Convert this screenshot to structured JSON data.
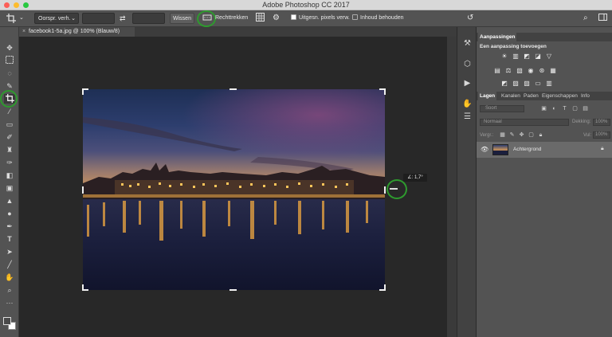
{
  "window": {
    "title": "Adobe Photoshop CC 2017"
  },
  "options_bar": {
    "ratio_select": "Oorspr. verh.",
    "clear_button": "Wissen",
    "straighten_label": "Rechttrekken",
    "delete_cropped_label": "Uitgesn. pixels verw.",
    "content_aware_label": "Inhoud behouden"
  },
  "document": {
    "tab_title": "facebook1-5a.jpg @ 100% (Blauw/8)",
    "angle_readout": "∠: 1,7°"
  },
  "adjustments_panel": {
    "tab": "Aanpassingen",
    "heading": "Een aanpassing toevoegen"
  },
  "layers_panel": {
    "tabs": [
      "Lagen",
      "Kanalen",
      "Paden",
      "Eigenschappen",
      "Info"
    ],
    "kind_filter": "Soort",
    "blend_mode": "Normaal",
    "opacity_label": "Dekking:",
    "opacity_value": "100%",
    "lock_label": "Vergr.:",
    "fill_label": "Vul:",
    "fill_value": "100%",
    "layers": [
      {
        "name": "Achtergrond"
      }
    ]
  },
  "colors": {
    "highlight_ring": "#2e9a2e",
    "ui_dark": "#282828",
    "panel_bg": "#535353"
  }
}
